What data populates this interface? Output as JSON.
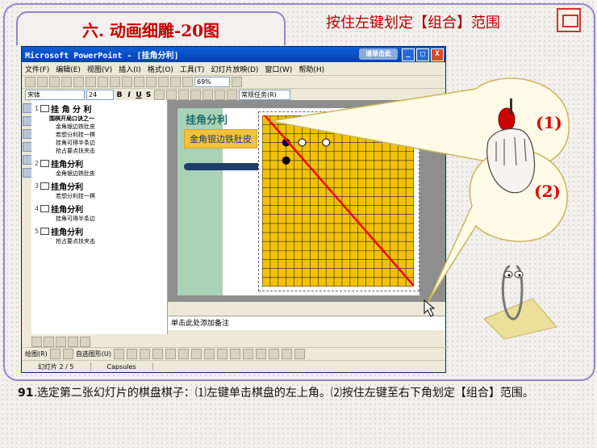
{
  "slide_title": "六. 动画细雕-20图",
  "header_hint": "按住左键划定【组合】范围",
  "window": {
    "title": "Microsoft PowerPoint - [挂角分利]",
    "stamp": "请单击此",
    "buttons": [
      "_",
      "□",
      "X"
    ]
  },
  "menu": [
    "文件(F)",
    "编辑(E)",
    "视图(V)",
    "插入(I)",
    "格式(O)",
    "工具(T)",
    "幻灯片放映(D)",
    "窗口(W)",
    "帮助(H)"
  ],
  "toolbar": {
    "zoom": "69%",
    "font": "宋体",
    "size": "24",
    "bold": "B",
    "italic": "I",
    "underline": "U",
    "shadow": "S",
    "tasks": "常规任务(R)"
  },
  "outline": [
    {
      "num": "1",
      "title": "挂 角 分 利",
      "subs": [
        {
          "text": "围棋开局口诀之一",
          "bold": true
        },
        {
          "text": "金角银边铁肚皮"
        },
        {
          "text": "若想分利挂一棋"
        },
        {
          "text": "挂角可得半条边"
        },
        {
          "text": "抢占要点扶夹击"
        }
      ]
    },
    {
      "num": "2",
      "title": "挂角分利",
      "subs": [
        {
          "text": "金角银边铁肚皮"
        }
      ]
    },
    {
      "num": "3",
      "title": "挂角分利",
      "subs": [
        {
          "text": "若想分利挂一棋"
        }
      ]
    },
    {
      "num": "4",
      "title": "挂角分利",
      "subs": [
        {
          "text": "挂角可得半条边"
        }
      ]
    },
    {
      "num": "5",
      "title": "挂角分利",
      "subs": [
        {
          "text": "抢占要点扶夹击"
        }
      ]
    }
  ],
  "slide": {
    "heading": "挂角分利",
    "tag": "金角银边铁肚皮",
    "board_color": "#f2c200"
  },
  "notes_placeholder": "单击此处添加备注",
  "drawbar": {
    "draw": "绘图(R)",
    "autoshapes": "自选图形(U)"
  },
  "status": {
    "slide_info": "幻灯片 2 / 5",
    "design": "Capsules"
  },
  "callouts": {
    "step1": "(1)",
    "step2": "(2)"
  },
  "caption": {
    "number": "91",
    "text": ".选定第二张幻灯片的棋盘棋子：⑴左键单击棋盘的左上角。⑵按住左键至右下角划定【组合】范围。"
  },
  "colors": {
    "accent_red": "#d00000",
    "frame": "#8f86c9",
    "selection_line": "#ff0000"
  }
}
